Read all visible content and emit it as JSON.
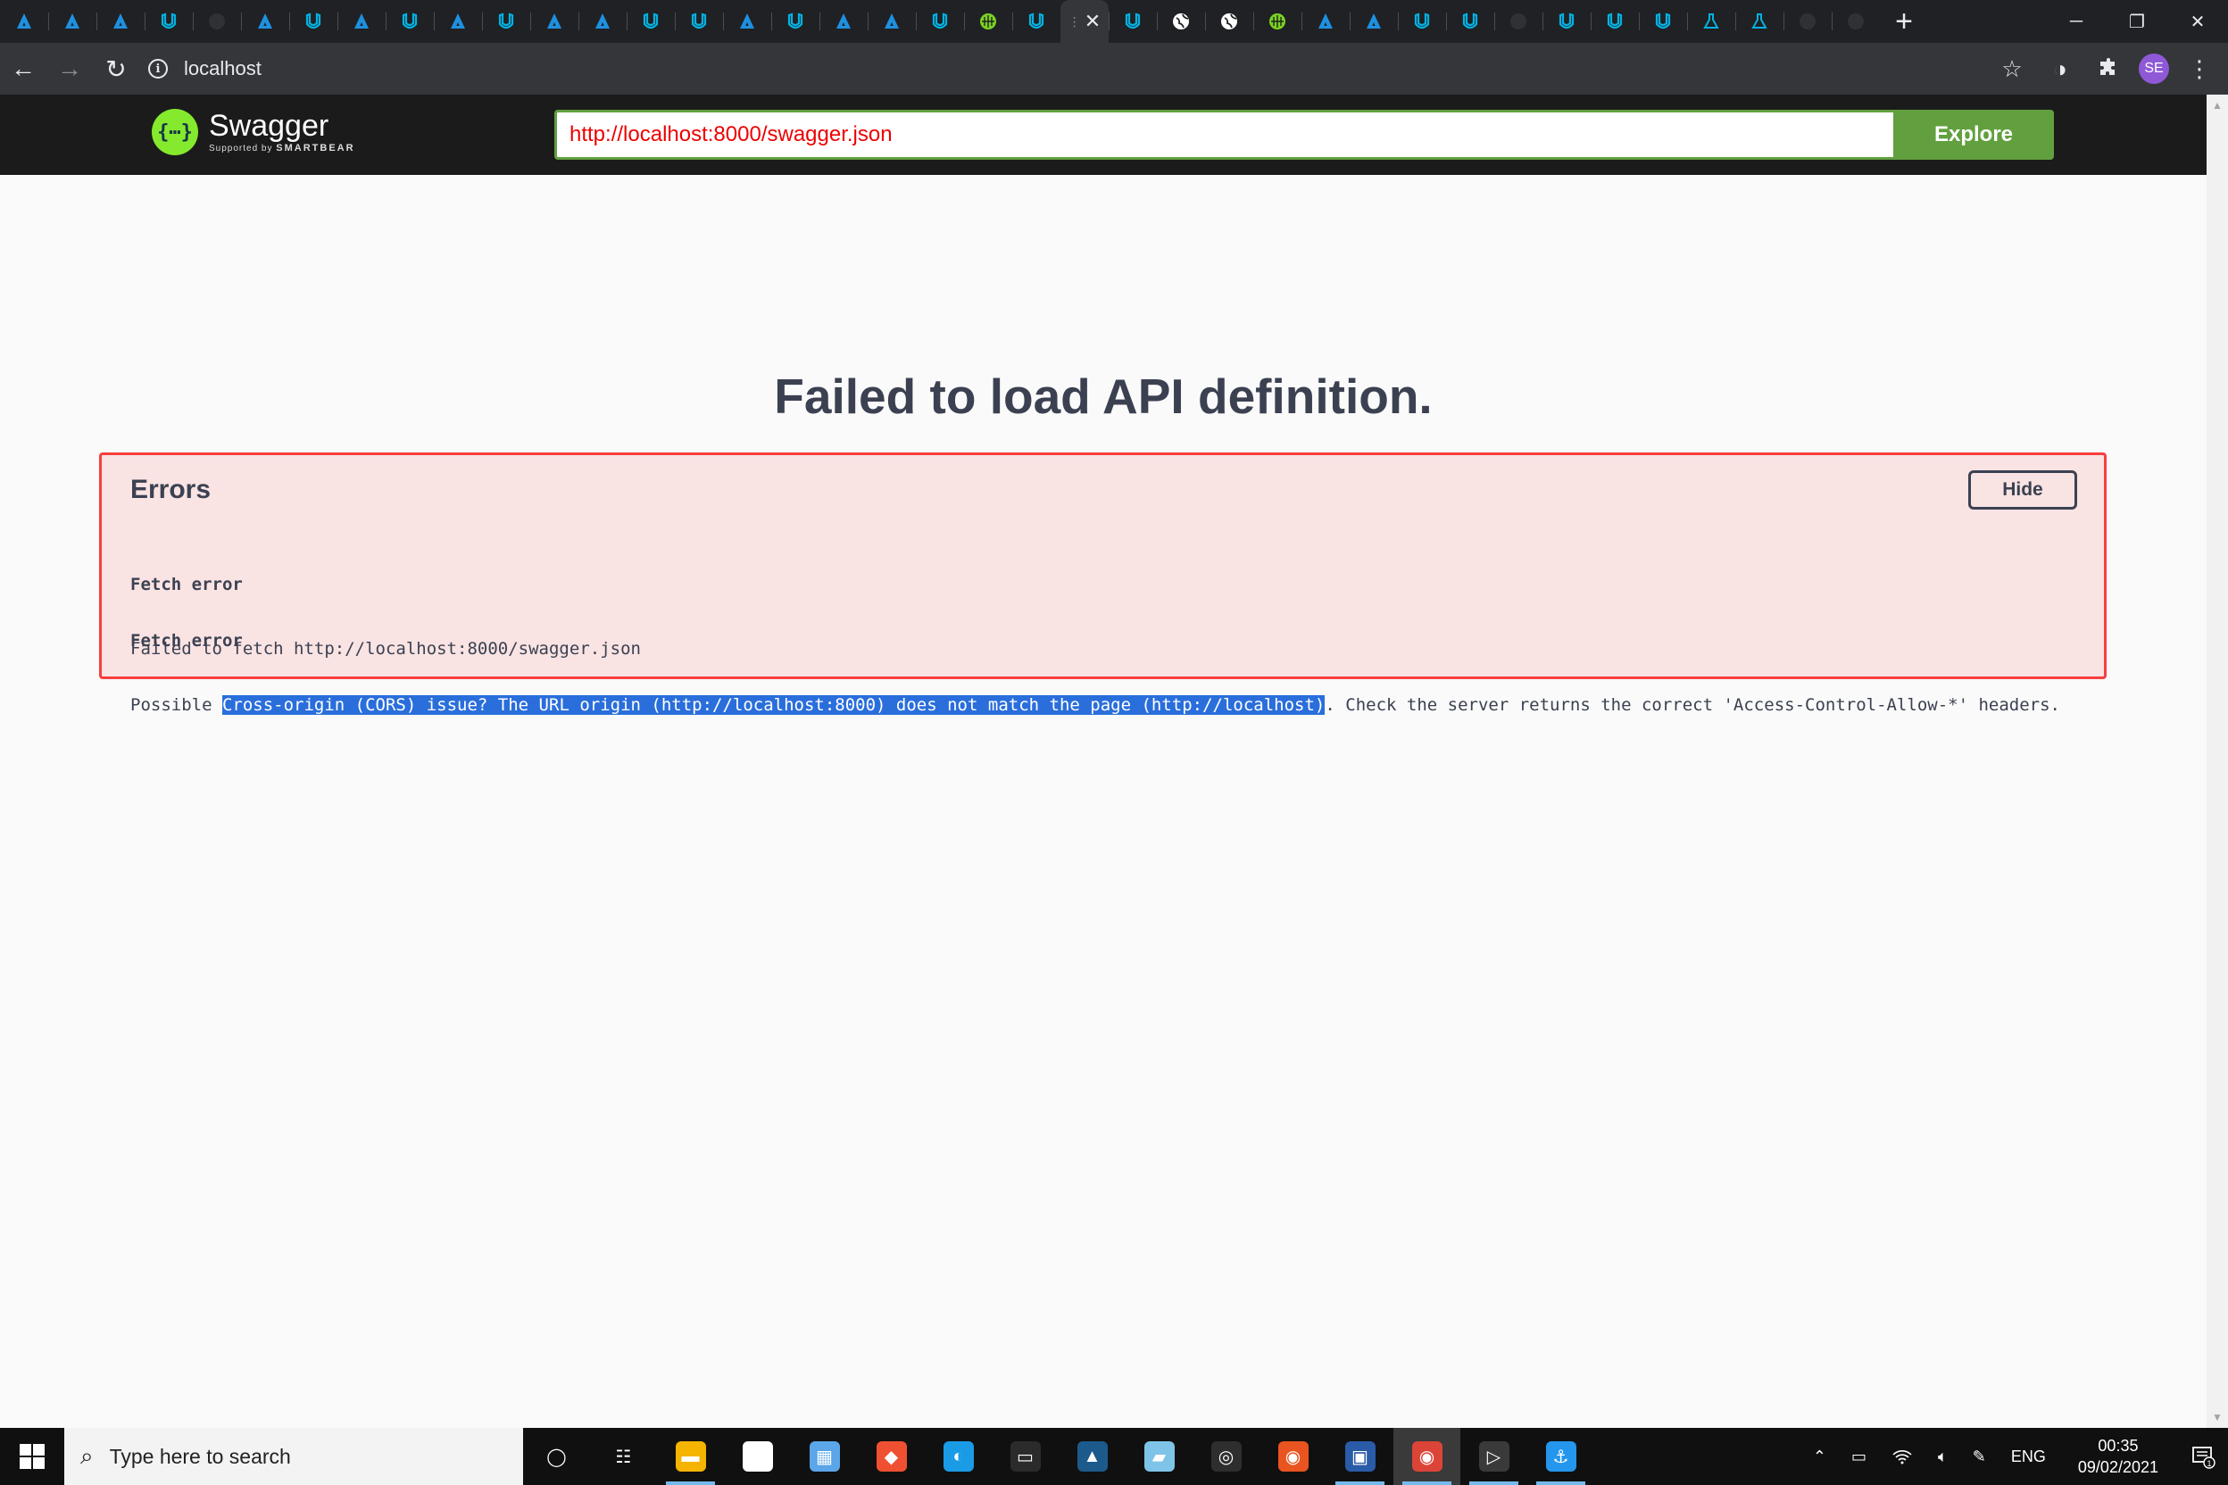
{
  "browser": {
    "tab_favicons": [
      "azure",
      "azure",
      "azure",
      "udacity",
      "github",
      "azure",
      "udacity",
      "azure",
      "udacity",
      "azure",
      "udacity",
      "azure",
      "azure",
      "udacity",
      "udacity",
      "azure",
      "udacity",
      "azure",
      "azure",
      "udacity",
      "green-globe",
      "udacity",
      "active",
      "udacity",
      "globe",
      "globe",
      "green-globe",
      "azure",
      "azure",
      "udacity",
      "udacity",
      "github",
      "udacity",
      "udacity",
      "udacity",
      "flask",
      "flask",
      "github",
      "github"
    ],
    "new_tab_label": "+",
    "address": "localhost",
    "profile_initials": "SE",
    "colors": {
      "tabstrip": "#202124",
      "toolbar": "#35363a",
      "azure": "#1e90e0",
      "udacity": "#02b3e4"
    }
  },
  "swagger": {
    "brand": "Swagger",
    "brand_sub_prefix": "Supported by",
    "brand_sub_company": "SMARTBEAR",
    "url_value": "http://localhost:8000/swagger.json",
    "explore_label": "Explore",
    "colors": {
      "bar": "#1b1b1b",
      "accent": "#62a03f",
      "logo": "#85ea2d"
    }
  },
  "main": {
    "title": "Failed to load API definition.",
    "errors": {
      "heading": "Errors",
      "hide_label": "Hide",
      "items": [
        {
          "heading": "Fetch error",
          "message": "Failed to fetch http://localhost:8000/swagger.json"
        },
        {
          "heading": "Fetch error",
          "message_before": "Possible ",
          "message_selected": "Cross-origin (CORS) issue? The URL origin (http://localhost:8000) does not match the page (http://localhost)",
          "message_after": ". Check the server returns the correct 'Access-Control-Allow-*' headers."
        }
      ],
      "colors": {
        "background": "#f9e3e3",
        "border": "#f93e3e",
        "selection": "#2a6edc"
      }
    }
  },
  "taskbar": {
    "search_placeholder": "Type here to search",
    "apps": [
      "cortana",
      "task-view",
      "file-explorer",
      "video-editor",
      "paint",
      "git",
      "edge",
      "terminal",
      "azure-studio",
      "notepad",
      "obs",
      "ubuntu",
      "remote-desktop",
      "chrome",
      "windows-terminal",
      "docker"
    ],
    "language": "ENG",
    "time": "00:35",
    "date": "09/02/2021",
    "notification_count": "1"
  }
}
